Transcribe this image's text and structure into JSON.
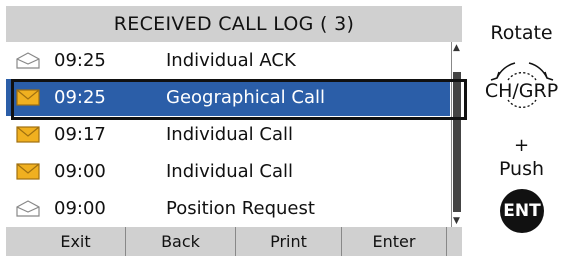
{
  "title": "RECEIVED CALL LOG ( 3)",
  "calls": [
    {
      "time": "09:25",
      "label": "Individual ACK",
      "icon": "envelope-open-icon",
      "read": true,
      "selected": false
    },
    {
      "time": "09:25",
      "label": "Geographical Call",
      "icon": "envelope-unread-icon",
      "read": false,
      "selected": true
    },
    {
      "time": "09:17",
      "label": "Individual Call",
      "icon": "envelope-unread-icon",
      "read": false,
      "selected": false
    },
    {
      "time": "09:00",
      "label": "Individual Call",
      "icon": "envelope-unread-icon",
      "read": false,
      "selected": false
    },
    {
      "time": "09:00",
      "label": "Position Request",
      "icon": "envelope-open-icon",
      "read": true,
      "selected": false
    }
  ],
  "softkeys": [
    "Exit",
    "Back",
    "Print",
    "Enter"
  ],
  "instructions": {
    "rotate": "Rotate",
    "knob_label": "CH/GRP",
    "plus": "+",
    "push": "Push",
    "ent_key": "ENT"
  },
  "colors": {
    "title_bar": "#d0d0d0",
    "selection": "#2b5ea8",
    "unread_envelope": "#f0b020",
    "read_envelope": "#ffffff"
  }
}
